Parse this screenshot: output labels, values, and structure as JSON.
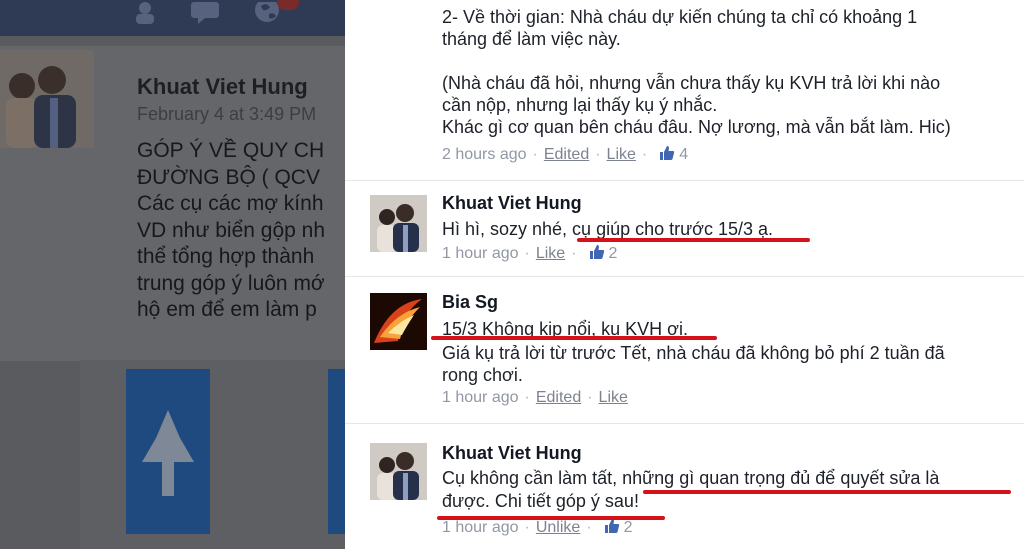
{
  "top_comment": {
    "lines": [
      "2- Về thời gian: Nhà cháu dự kiến chúng ta chỉ có khoảng 1",
      "tháng để làm việc này.",
      "",
      "(Nhà cháu đã hỏi, nhưng vẫn chưa thấy kụ KVH trả lời khi nào",
      "cần nộp, nhưng lại thấy kụ ý nhắc.",
      "Khác gì cơ quan bên cháu đâu. Nợ lương, mà vẫn bắt làm. Hic)"
    ],
    "time": "2 hours ago",
    "edited": "Edited",
    "like": "Like",
    "likes": "4"
  },
  "comments": [
    {
      "author": "Khuat Viet Hung",
      "lines": [
        "Hì hì, sozy nhé, cụ giúp cho trước 15/3 ạ."
      ],
      "time": "1 hour ago",
      "like": "Like",
      "likes": "2"
    },
    {
      "author": "Bia Sg",
      "lines": [
        "15/3 Không kịp nổi, ku KVH ơi.",
        "Giá kụ trả lời từ trước Tết, nhà cháu đã không bỏ phí 2 tuần đã",
        "rong chơi."
      ],
      "time": "1 hour ago",
      "edited": "Edited",
      "like": "Like"
    },
    {
      "author": "Khuat Viet Hung",
      "lines": [
        "Cụ không cần làm tất, những gì quan trọng đủ để quyết sửa là",
        "được. Chi tiết góp ý sau!"
      ],
      "time": "1 hour ago",
      "unlike": "Unlike",
      "likes": "2"
    }
  ],
  "left_post": {
    "author": "Khuat Viet Hung",
    "date": "February 4 at 3:49 PM",
    "body_lines": [
      "GÓP Ý VỀ QUY CH",
      "ĐƯỜNG BỘ ( QCV",
      "Các cụ các mợ kính",
      "VD như biển gộp nh",
      "thể tổng hợp thành",
      "trung góp ý luôn mớ",
      "hộ em để em làm p"
    ]
  },
  "icons": {
    "friends": "friends-icon",
    "messages": "messages-icon",
    "notifications": "globe-icon",
    "like": "thumbs-up-icon",
    "attachment": "pin-icon"
  },
  "colors": {
    "link": "#7d8291",
    "like_thumb": "#4267b2",
    "annotation_underline": "#d3121a",
    "header_bar": "#2f3a54"
  }
}
